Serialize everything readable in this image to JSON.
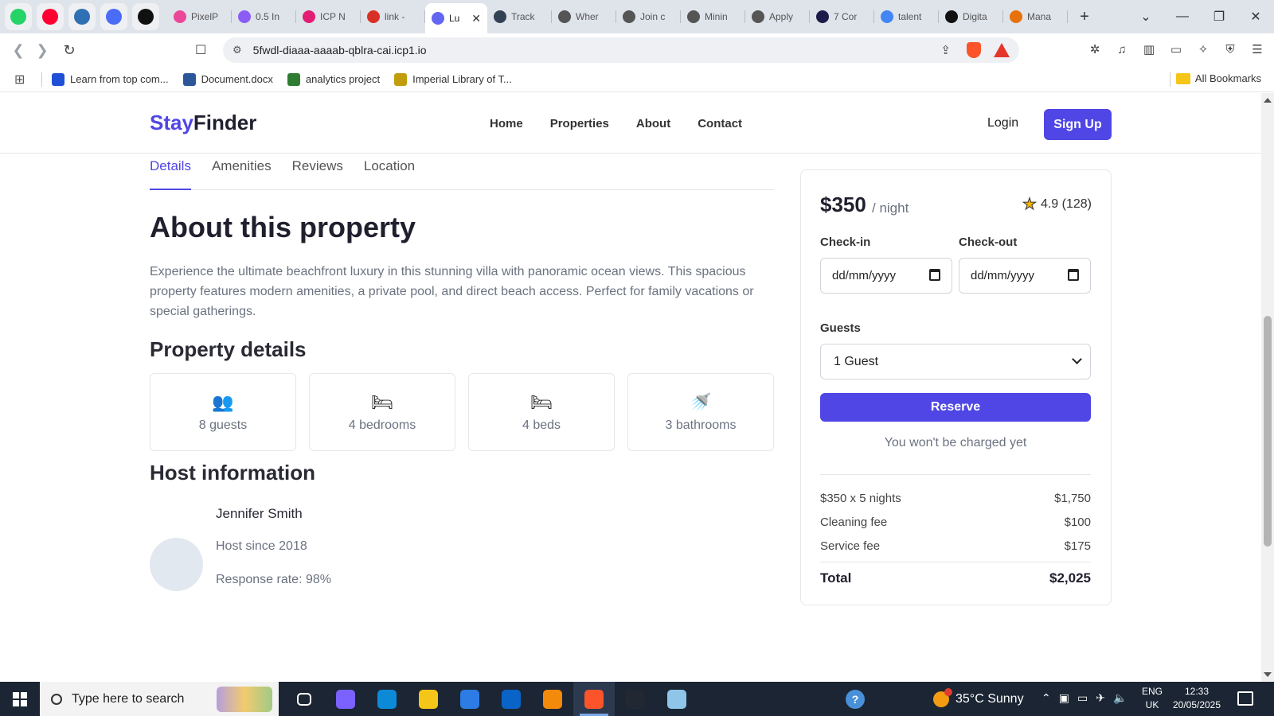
{
  "browser": {
    "pinned_tabs": [
      {
        "icon": "whatsapp-icon",
        "color": "#25d366"
      },
      {
        "icon": "youtube-music-icon",
        "color": "#ff0033"
      },
      {
        "icon": "database-icon",
        "color": "#2f6fb3"
      },
      {
        "icon": "web3-icon",
        "color": "#4a6cf7"
      },
      {
        "icon": "openai-icon",
        "color": "#111111"
      }
    ],
    "tabs": [
      {
        "title": "PixelP",
        "icon": "infinity-icon",
        "color": "#ec4899",
        "active": false
      },
      {
        "title": "0.5 In",
        "icon": "infinity-icon",
        "color": "#8b5cf6",
        "active": false
      },
      {
        "title": "ICP N",
        "icon": "icp-star-icon",
        "color": "#e11d74",
        "active": false
      },
      {
        "title": "link -",
        "icon": "gmail-icon",
        "color": "#d93025",
        "active": false
      },
      {
        "title": "Lu",
        "icon": "infinity-icon",
        "color": "#6366f1",
        "active": true
      },
      {
        "title": "Track",
        "icon": "tracker-icon",
        "color": "#334155",
        "active": false
      },
      {
        "title": "Wher",
        "icon": "openai-icon",
        "color": "#555555",
        "active": false
      },
      {
        "title": "Join c",
        "icon": "openai-icon",
        "color": "#555555",
        "active": false
      },
      {
        "title": "Minin",
        "icon": "openai-icon",
        "color": "#555555",
        "active": false
      },
      {
        "title": "Apply",
        "icon": "openai-icon",
        "color": "#555555",
        "active": false
      },
      {
        "title": "7 Cor",
        "icon": "r-logo-icon",
        "color": "#1e1b4b",
        "active": false
      },
      {
        "title": "talent",
        "icon": "google-icon",
        "color": "#4285f4",
        "active": false
      },
      {
        "title": "Digita",
        "icon": "video-logo-icon",
        "color": "#111111",
        "active": false
      },
      {
        "title": "Mana",
        "icon": "people-icon",
        "color": "#e8710a",
        "active": false
      }
    ],
    "url": "5fwdl-diaaa-aaaab-qblra-cai.icp1.io",
    "bookmarks": [
      {
        "label": "Learn from top com...",
        "icon": "diamond-icon",
        "color": "#1e4fd6"
      },
      {
        "label": "Document.docx",
        "icon": "word-icon",
        "color": "#2b579a"
      },
      {
        "label": "analytics project",
        "icon": "infinity-icon",
        "color": "#2e7d32"
      },
      {
        "label": "Imperial Library of T...",
        "icon": "library-icon",
        "color": "#c29d0b"
      }
    ],
    "all_bookmarks_label": "All Bookmarks"
  },
  "site": {
    "logo_part1": "Stay",
    "logo_part2": "Finder",
    "nav": [
      "Home",
      "Properties",
      "About",
      "Contact"
    ],
    "login_label": "Login",
    "signup_label": "Sign Up",
    "accent_color": "#4f46e5"
  },
  "property": {
    "tabs": [
      "Details",
      "Amenities",
      "Reviews",
      "Location"
    ],
    "active_tab": "Details",
    "about_title": "About this property",
    "description": "Experience the ultimate beachfront luxury in this stunning villa with panoramic ocean views. This spacious property features modern amenities, a private pool, and direct beach access. Perfect for family vacations or special gatherings.",
    "details_title": "Property details",
    "details": [
      {
        "icon": "guests-icon",
        "glyph": "👥",
        "label": "8 guests"
      },
      {
        "icon": "bed-icon",
        "glyph": "🛏",
        "label": "4 bedrooms"
      },
      {
        "icon": "bed-icon",
        "glyph": "🛏",
        "label": "4 beds"
      },
      {
        "icon": "bathtub-icon",
        "glyph": "🚿",
        "label": "3 bathrooms"
      }
    ],
    "host_title": "Host information",
    "host": {
      "name": "Jennifer Smith",
      "since": "Host since 2018",
      "response": "Response rate: 98%"
    }
  },
  "booking": {
    "price": "$350",
    "per": "/ night",
    "rating": "4.9 (128)",
    "checkin_label": "Check-in",
    "checkout_label": "Check-out",
    "date_placeholder": "dd/mm/yyyy",
    "guests_label": "Guests",
    "guests_value": "1 Guest",
    "reserve_label": "Reserve",
    "note": "You won't be charged yet",
    "lines": [
      {
        "label": "$350 x 5 nights",
        "value": "$1,750"
      },
      {
        "label": "Cleaning fee",
        "value": "$100"
      },
      {
        "label": "Service fee",
        "value": "$175"
      }
    ],
    "total_label": "Total",
    "total_value": "$2,025"
  },
  "taskbar": {
    "search_placeholder": "Type here to search",
    "apps": [
      {
        "icon": "task-view-icon",
        "color": "#1b2533"
      },
      {
        "icon": "copilot-icon",
        "color": "#7b61ff"
      },
      {
        "icon": "edge-icon",
        "color": "#0c8ad8"
      },
      {
        "icon": "file-explorer-icon",
        "color": "#f5c518"
      },
      {
        "icon": "microsoft-store-icon",
        "color": "#2d7be5"
      },
      {
        "icon": "outlook-icon",
        "color": "#0a64c8"
      },
      {
        "icon": "vlc-icon",
        "color": "#f48a0b"
      },
      {
        "icon": "brave-icon",
        "color": "#fb542b"
      },
      {
        "icon": "terminal-icon",
        "color": "#222831"
      },
      {
        "icon": "notepad-icon",
        "color": "#8ec5e8"
      }
    ],
    "weather": "35°C  Sunny",
    "lang_line1": "ENG",
    "lang_line2": "UK",
    "time": "12:33",
    "date": "20/05/2025"
  }
}
